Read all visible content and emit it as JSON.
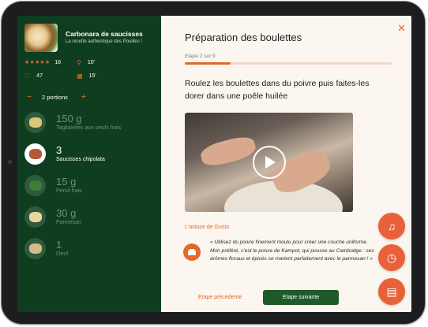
{
  "recipe": {
    "title": "Carbonara de saucisses",
    "subtitle": "La recette authentique des Pouilles !",
    "rating": "16",
    "prep_time": "10'",
    "likes": "47",
    "cook_time": "15'",
    "portions_label": "2 portions"
  },
  "ingredients": [
    {
      "qty": "150 g",
      "name": "Tagliatelles aux oeufs frais",
      "color": "#d9c77a"
    },
    {
      "qty": "3",
      "name": "Saucisses chipolata",
      "color": "#b5573b"
    },
    {
      "qty": "15 g",
      "name": "Persil frais",
      "color": "#3e7d34"
    },
    {
      "qty": "30 g",
      "name": "Parmesan",
      "color": "#e8d8a0"
    },
    {
      "qty": "1",
      "name": "Oeuf",
      "color": "#d7b98a"
    }
  ],
  "step": {
    "title": "Préparation des boulettes",
    "counter": "Etape 2 sur 9",
    "progress": 0.22,
    "instruction": "Roulez les boulettes dans du poivre puis faites-les dorer dans une poêle huilée"
  },
  "tip": {
    "title": "L'astuce de Gusto",
    "text": "« Utilisez du poivre finement moulu pour créer une couche uniforme. Mon préféré, c'est le poivre de Kampot, qui pousse au Cambodge : ses arômes floraux et épicés se marient parfaitement avec le parmesan ! »"
  },
  "nav": {
    "prev_label": "Etape précédente",
    "next_label": "Etape suivante"
  },
  "colors": {
    "sidebar": "#0f3d1f",
    "accent": "#e4682a",
    "primary_button": "#1f5a2a"
  }
}
